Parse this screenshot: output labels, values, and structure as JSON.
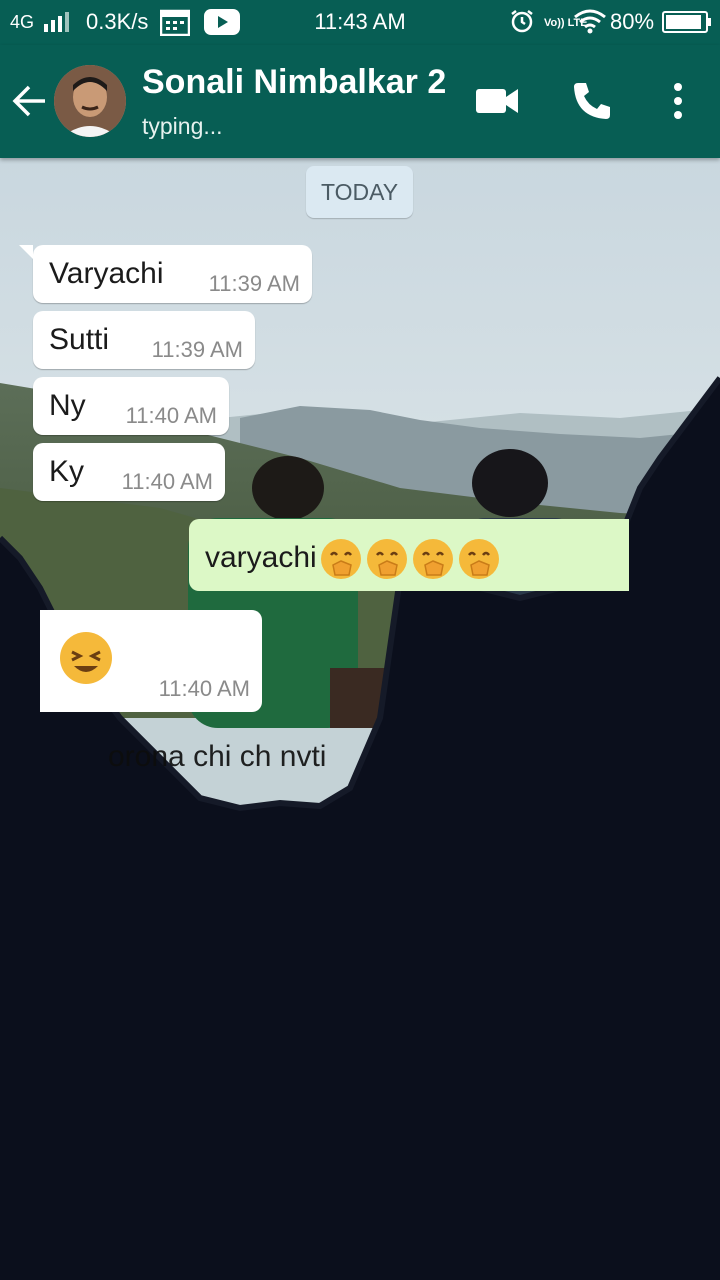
{
  "status_bar": {
    "network": "4G",
    "speed": "0.3K/s",
    "time": "11:43 AM",
    "volte": "Vo)) LTE",
    "battery": "80%"
  },
  "header": {
    "contact_name": "Sonali Nimbalkar 2",
    "contact_status": "typing..."
  },
  "chat": {
    "date_label": "TODAY",
    "incoming": [
      {
        "text": "Varyachi",
        "time": "11:39 AM"
      },
      {
        "text": "Sutti",
        "time": "11:39 AM"
      },
      {
        "text": "Ny",
        "time": "11:40 AM"
      },
      {
        "text": "Ky",
        "time": "11:40 AM"
      }
    ],
    "outgoing": {
      "text": "varyachi",
      "emoji_count": 4
    },
    "partial_incoming": {
      "time": "11:40 AM"
    },
    "overlay_text": "orona chi ch nvti"
  },
  "colors": {
    "header": "#075e54",
    "outgoing_bubble": "#dcf8c6",
    "incoming_bubble": "#ffffff",
    "date_chip": "#dbe9f2"
  }
}
